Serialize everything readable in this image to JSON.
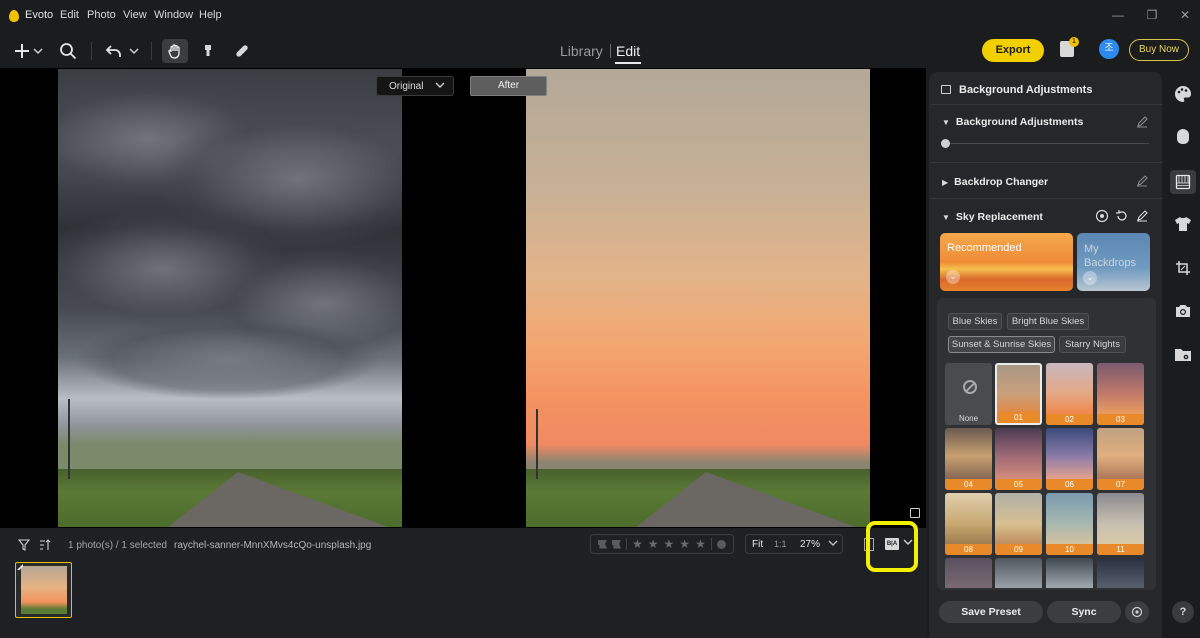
{
  "app": {
    "name": "Evoto"
  },
  "menu": [
    "Edit",
    "Photo",
    "View",
    "Window",
    "Help"
  ],
  "nav": {
    "library": "Library",
    "edit": "Edit"
  },
  "header": {
    "export": "Export",
    "badge_count": "1",
    "avatar_letter": "조",
    "buy_now": "Buy Now"
  },
  "canvas": {
    "original_label": "Original",
    "after_label": "After"
  },
  "status": {
    "photo_count": "1 photo(s) / 1 selected",
    "filename": "raychel-sanner-MnnXMvs4cQo-unsplash.jpg",
    "fit": "Fit",
    "one_to_one": "1:1",
    "zoom": "27%",
    "ba_icon_text": "B|A"
  },
  "panel": {
    "title": "Background Adjustments",
    "sections": {
      "bg_adjust": "Background Adjustments",
      "backdrop": "Backdrop Changer",
      "sky": "Sky Replacement"
    },
    "sky": {
      "recommended": "Recommended",
      "my_backdrops": "My Backdrops",
      "chips": [
        "Blue Skies",
        "Bright Blue Skies",
        "Sunset & Sunrise Skies",
        "Starry Nights"
      ],
      "selected_chip": "Sunset & Sunrise Skies",
      "none_label": "None",
      "tiles": [
        "01",
        "02",
        "03",
        "04",
        "05",
        "06",
        "07",
        "08",
        "09",
        "10",
        "11"
      ],
      "selected_tile": "01"
    },
    "save_preset": "Save Preset",
    "sync": "Sync"
  },
  "colors": {
    "accent": "#f2d000",
    "highlight": "#f5f000",
    "tile_label": "#e88a2a"
  }
}
